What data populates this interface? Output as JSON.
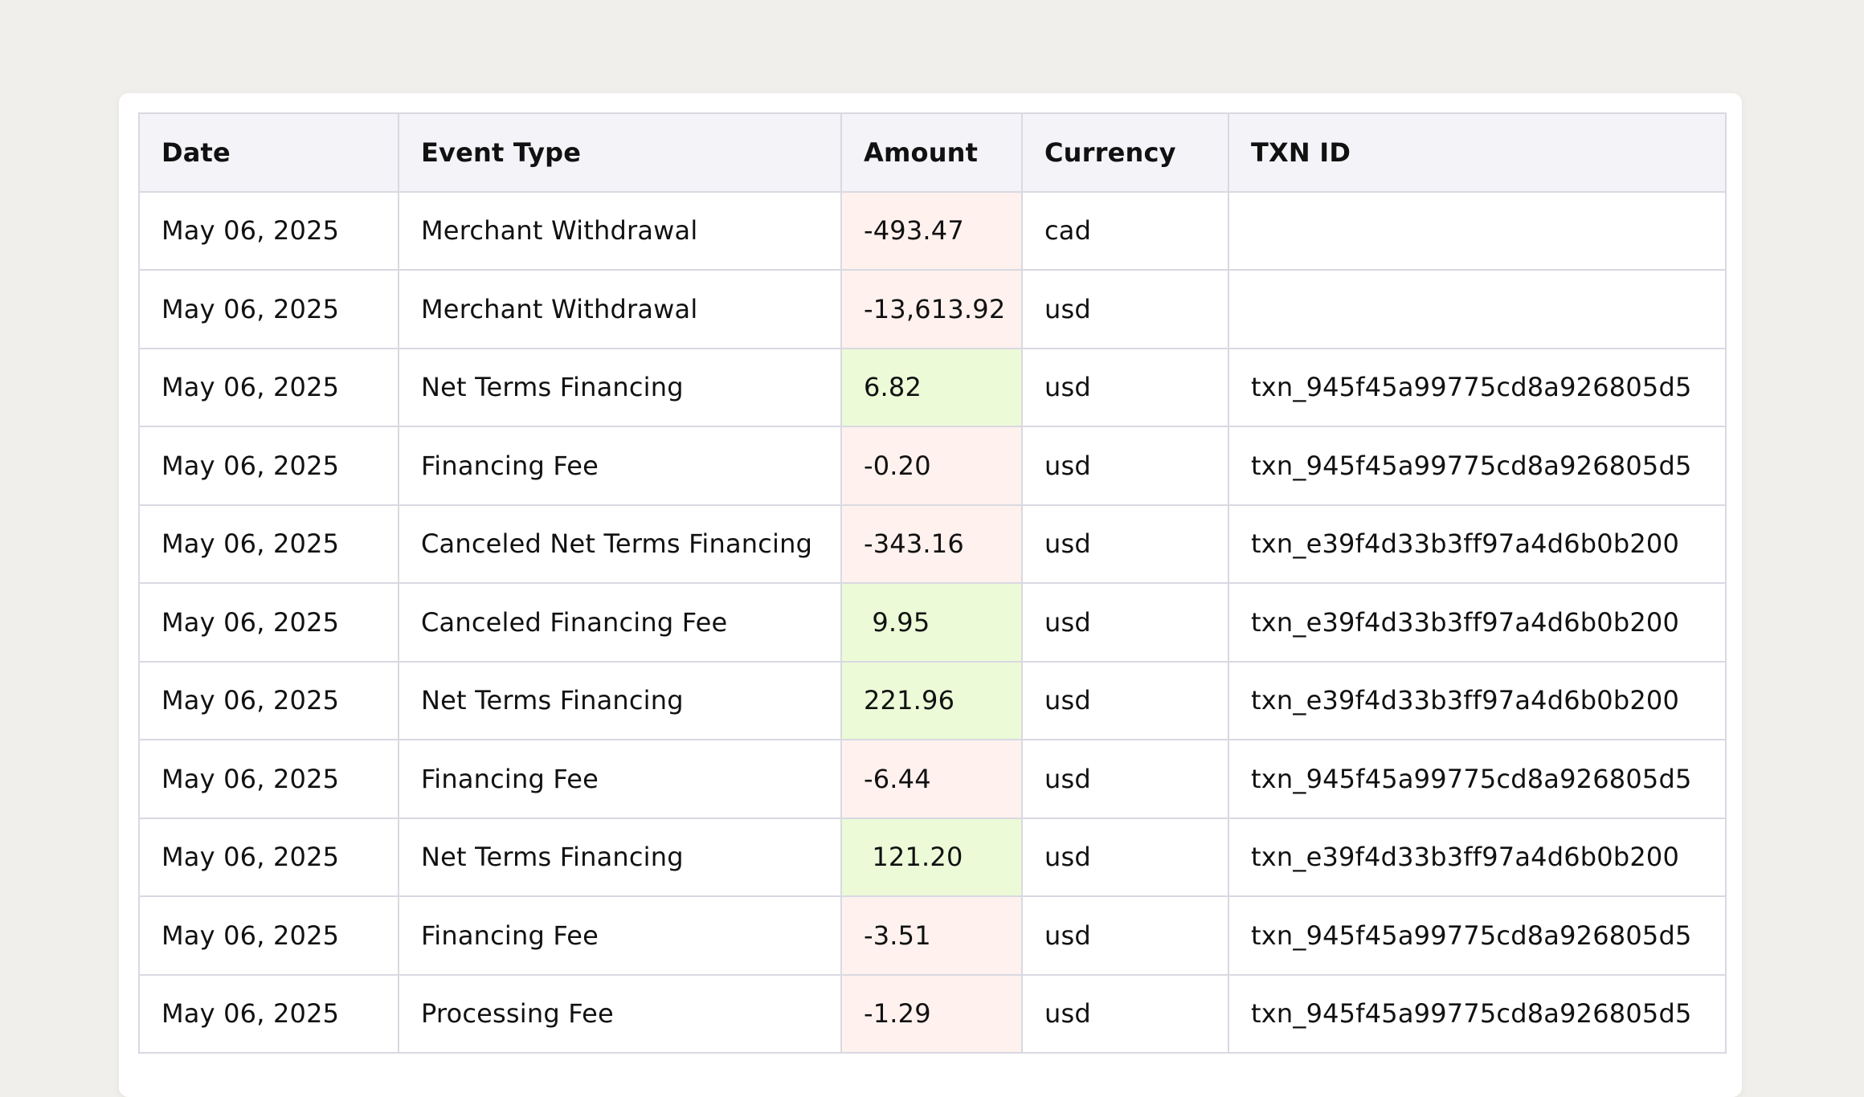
{
  "table": {
    "headers": [
      "Date",
      "Event Type",
      "Amount",
      "Currency",
      "TXN ID"
    ],
    "rows": [
      {
        "date": "May 06, 2025",
        "event_type": "Merchant Withdrawal",
        "amount": "-493.47",
        "sign": "negative",
        "currency": "cad",
        "txn_id": ""
      },
      {
        "date": "May 06, 2025",
        "event_type": "Merchant Withdrawal",
        "amount": "-13,613.92",
        "sign": "negative",
        "currency": "usd",
        "txn_id": ""
      },
      {
        "date": "May 06, 2025",
        "event_type": "Net Terms Financing",
        "amount": "6.82",
        "sign": "positive",
        "currency": "usd",
        "txn_id": "txn_945f45a99775cd8a926805d5"
      },
      {
        "date": "May 06, 2025",
        "event_type": "Financing Fee",
        "amount": "-0.20",
        "sign": "negative",
        "currency": "usd",
        "txn_id": "txn_945f45a99775cd8a926805d5"
      },
      {
        "date": "May 06, 2025",
        "event_type": "Canceled Net Terms Financing",
        "amount": "-343.16",
        "sign": "negative",
        "currency": "usd",
        "txn_id": "txn_e39f4d33b3ff97a4d6b0b200"
      },
      {
        "date": "May 06, 2025",
        "event_type": "Canceled Financing Fee",
        "amount": " 9.95",
        "sign": "positive",
        "currency": "usd",
        "txn_id": "txn_e39f4d33b3ff97a4d6b0b200"
      },
      {
        "date": "May 06, 2025",
        "event_type": "Net Terms Financing",
        "amount": "221.96",
        "sign": "positive",
        "currency": "usd",
        "txn_id": "txn_e39f4d33b3ff97a4d6b0b200"
      },
      {
        "date": "May 06, 2025",
        "event_type": "Financing Fee",
        "amount": "-6.44",
        "sign": "negative",
        "currency": "usd",
        "txn_id": "txn_945f45a99775cd8a926805d5"
      },
      {
        "date": "May 06, 2025",
        "event_type": "Net Terms Financing",
        "amount": " 121.20",
        "sign": "positive",
        "currency": "usd",
        "txn_id": "txn_e39f4d33b3ff97a4d6b0b200"
      },
      {
        "date": "May 06, 2025",
        "event_type": "Financing Fee",
        "amount": "-3.51",
        "sign": "negative",
        "currency": "usd",
        "txn_id": "txn_945f45a99775cd8a926805d5"
      },
      {
        "date": "May 06, 2025",
        "event_type": "Processing Fee",
        "amount": "-1.29",
        "sign": "negative",
        "currency": "usd",
        "txn_id": "txn_945f45a99775cd8a926805d5"
      }
    ]
  },
  "colors": {
    "page_background": "#f0efec",
    "card_background": "#ffffff",
    "header_background": "#f3f3f8",
    "border": "#d9d9e2",
    "negative_amount_background": "#fef1ee",
    "positive_amount_background": "#ecfad7"
  }
}
